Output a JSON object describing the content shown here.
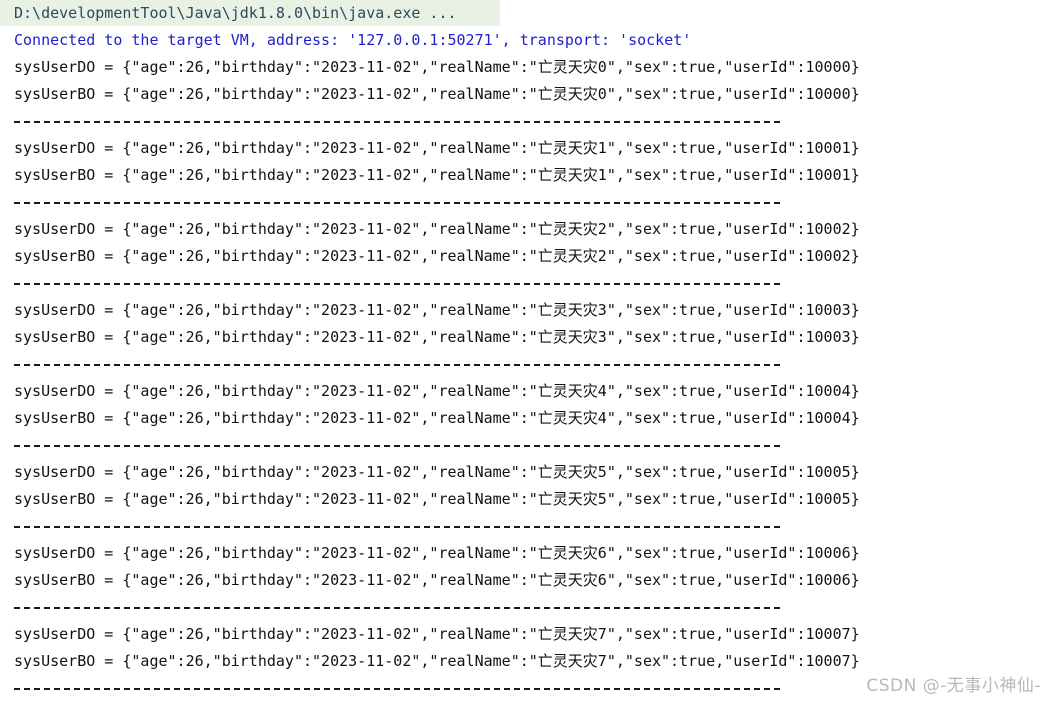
{
  "console": {
    "command_line": "D:\\developmentTool\\Java\\jdk1.8.0\\bin\\java.exe ...",
    "connected_line": "Connected to the target VM, address: '127.0.0.1:50271', transport: 'socket'",
    "separator": "---------------------------------------------------------------------------",
    "colors": {
      "command_background": "#e8f1e4",
      "command_text": "#2b4a5c",
      "connected_text": "#2020d0",
      "body_text": "#121212",
      "separator": "#1a1a1a",
      "watermark": "#b9b9b9",
      "page_background": "#ffffff"
    },
    "entries": [
      {
        "do_line": "sysUserDO = {\"age\":26,\"birthday\":\"2023-11-02\",\"realName\":\"亡灵天灾0\",\"sex\":true,\"userId\":10000}",
        "bo_line": "sysUserBO = {\"age\":26,\"birthday\":\"2023-11-02\",\"realName\":\"亡灵天灾0\",\"sex\":true,\"userId\":10000}"
      },
      {
        "do_line": "sysUserDO = {\"age\":26,\"birthday\":\"2023-11-02\",\"realName\":\"亡灵天灾1\",\"sex\":true,\"userId\":10001}",
        "bo_line": "sysUserBO = {\"age\":26,\"birthday\":\"2023-11-02\",\"realName\":\"亡灵天灾1\",\"sex\":true,\"userId\":10001}"
      },
      {
        "do_line": "sysUserDO = {\"age\":26,\"birthday\":\"2023-11-02\",\"realName\":\"亡灵天灾2\",\"sex\":true,\"userId\":10002}",
        "bo_line": "sysUserBO = {\"age\":26,\"birthday\":\"2023-11-02\",\"realName\":\"亡灵天灾2\",\"sex\":true,\"userId\":10002}"
      },
      {
        "do_line": "sysUserDO = {\"age\":26,\"birthday\":\"2023-11-02\",\"realName\":\"亡灵天灾3\",\"sex\":true,\"userId\":10003}",
        "bo_line": "sysUserBO = {\"age\":26,\"birthday\":\"2023-11-02\",\"realName\":\"亡灵天灾3\",\"sex\":true,\"userId\":10003}"
      },
      {
        "do_line": "sysUserDO = {\"age\":26,\"birthday\":\"2023-11-02\",\"realName\":\"亡灵天灾4\",\"sex\":true,\"userId\":10004}",
        "bo_line": "sysUserBO = {\"age\":26,\"birthday\":\"2023-11-02\",\"realName\":\"亡灵天灾4\",\"sex\":true,\"userId\":10004}"
      },
      {
        "do_line": "sysUserDO = {\"age\":26,\"birthday\":\"2023-11-02\",\"realName\":\"亡灵天灾5\",\"sex\":true,\"userId\":10005}",
        "bo_line": "sysUserBO = {\"age\":26,\"birthday\":\"2023-11-02\",\"realName\":\"亡灵天灾5\",\"sex\":true,\"userId\":10005}"
      },
      {
        "do_line": "sysUserDO = {\"age\":26,\"birthday\":\"2023-11-02\",\"realName\":\"亡灵天灾6\",\"sex\":true,\"userId\":10006}",
        "bo_line": "sysUserBO = {\"age\":26,\"birthday\":\"2023-11-02\",\"realName\":\"亡灵天灾6\",\"sex\":true,\"userId\":10006}"
      },
      {
        "do_line": "sysUserDO = {\"age\":26,\"birthday\":\"2023-11-02\",\"realName\":\"亡灵天灾7\",\"sex\":true,\"userId\":10007}",
        "bo_line": "sysUserBO = {\"age\":26,\"birthday\":\"2023-11-02\",\"realName\":\"亡灵天灾7\",\"sex\":true,\"userId\":10007}"
      }
    ]
  },
  "watermark": {
    "text": "CSDN @-无事小神仙-"
  }
}
